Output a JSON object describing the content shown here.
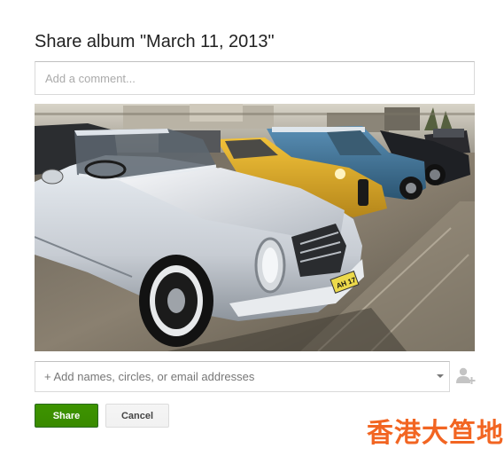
{
  "dialog": {
    "title": "Share album \"March 11, 2013\""
  },
  "comment": {
    "placeholder": "Add a comment...",
    "value": ""
  },
  "photo": {
    "plate_text": "AH 17"
  },
  "recipients": {
    "placeholder": "+ Add names, circles, or email addresses",
    "value": "",
    "add_icon": "add-person-icon"
  },
  "buttons": {
    "share_label": "Share",
    "cancel_label": "Cancel"
  },
  "watermark": {
    "text": "香港大笪地"
  },
  "colors": {
    "share_green": "#3d9400",
    "watermark_orange": "#f26522"
  }
}
